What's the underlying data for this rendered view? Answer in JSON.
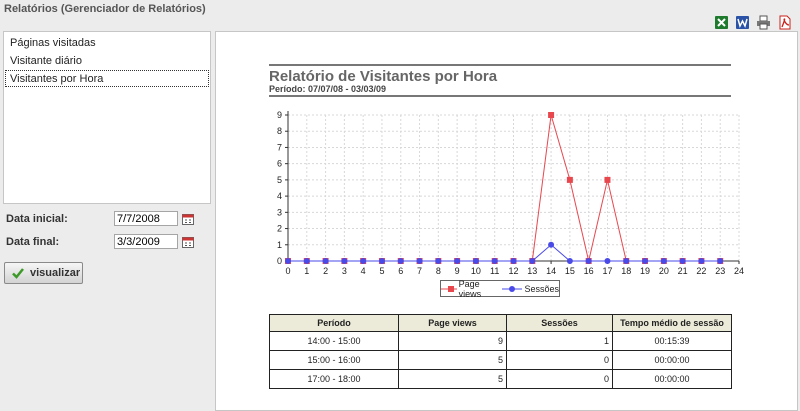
{
  "app": {
    "title": "Relatórios (Gerenciador de Relatórios)"
  },
  "export_icons": [
    {
      "name": "excel-icon",
      "color": "#1e7a2d"
    },
    {
      "name": "word-icon",
      "color": "#2a52a6"
    },
    {
      "name": "print-icon",
      "color": "#444444"
    },
    {
      "name": "pdf-icon",
      "color": "#c8201a"
    }
  ],
  "sidebar": {
    "reports": [
      {
        "label": "Páginas visitadas",
        "selected": false
      },
      {
        "label": "Visitante diário",
        "selected": false
      },
      {
        "label": "Visitantes por Hora",
        "selected": true
      }
    ],
    "start_label": "Data inicial:",
    "start_value": "7/7/2008",
    "end_label": "Data final:",
    "end_value": "3/3/2009",
    "view_button": "visualizar"
  },
  "report": {
    "title": "Relatório de Visitantes por Hora",
    "period": "Período: 07/07/08 - 03/03/09",
    "legend": {
      "page_views": "Page views",
      "sessions": "Sessões"
    },
    "table": {
      "headers": [
        "Período",
        "Page views",
        "Sessões",
        "Tempo médio de sessão"
      ],
      "rows": [
        [
          "14:00 - 15:00",
          "9",
          "1",
          "00:15:39"
        ],
        [
          "15:00 - 16:00",
          "5",
          "0",
          "00:00:00"
        ],
        [
          "17:00 - 18:00",
          "5",
          "0",
          "00:00:00"
        ]
      ]
    }
  },
  "chart_data": {
    "type": "line",
    "x": [
      0,
      1,
      2,
      3,
      4,
      5,
      6,
      7,
      8,
      9,
      10,
      11,
      12,
      13,
      14,
      15,
      16,
      17,
      18,
      19,
      20,
      21,
      22,
      23,
      24
    ],
    "xlim": [
      0,
      24
    ],
    "ylim": [
      0,
      9
    ],
    "grid": true,
    "legend_position": "bottom",
    "series": [
      {
        "name": "Page views",
        "color": "#e8474e",
        "marker": "square",
        "values": [
          0,
          0,
          0,
          0,
          0,
          0,
          0,
          0,
          0,
          0,
          0,
          0,
          0,
          0,
          9,
          5,
          0,
          5,
          0,
          0,
          0,
          0,
          0,
          0
        ]
      },
      {
        "name": "Sessões",
        "color": "#4a4ae8",
        "marker": "circle",
        "values": [
          0,
          0,
          0,
          0,
          0,
          0,
          0,
          0,
          0,
          0,
          0,
          0,
          0,
          0,
          1,
          0,
          0,
          0,
          0,
          0,
          0,
          0,
          0,
          0
        ]
      }
    ]
  }
}
